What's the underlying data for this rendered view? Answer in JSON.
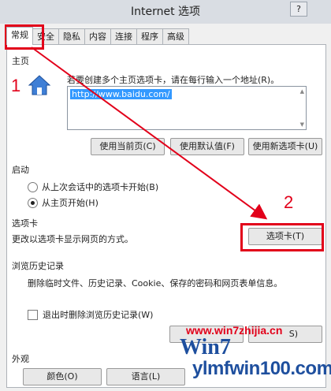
{
  "window": {
    "title": "Internet 选项",
    "help_glyph": "?"
  },
  "tabs": [
    "常规",
    "安全",
    "隐私",
    "内容",
    "连接",
    "程序",
    "高级"
  ],
  "home": {
    "section": "主页",
    "hint": "若要创建多个主页选项卡，请在每行输入一个地址(R)。",
    "url": "http://www.baidu.com/",
    "buttons": [
      "使用当前页(C)",
      "使用默认值(F)",
      "使用新选项卡(U)"
    ]
  },
  "startup": {
    "section": "启动",
    "options": [
      "从上次会话中的选项卡开始(B)",
      "从主页开始(H)"
    ],
    "selected_index": 1
  },
  "tabs_section": {
    "section": "选项卡",
    "desc": "更改以选项卡显示网页的方式。",
    "button": "选项卡(T)"
  },
  "history": {
    "section": "浏览历史记录",
    "desc": "删除临时文件、历史记录、Cookie、保存的密码和网页表单信息。",
    "checkbox": "退出时删除浏览历史记录(W)",
    "button_partial": "S)"
  },
  "appearance": {
    "section": "外观",
    "buttons": [
      "颜色(O)",
      "语言(L)"
    ]
  },
  "annotations": {
    "step1": "1",
    "step2": "2",
    "color": "#e2001a"
  },
  "watermark": {
    "logo": "Win7",
    "site1": "www.win7zhijia.cn",
    "site2": "ylmfwin100.com"
  }
}
